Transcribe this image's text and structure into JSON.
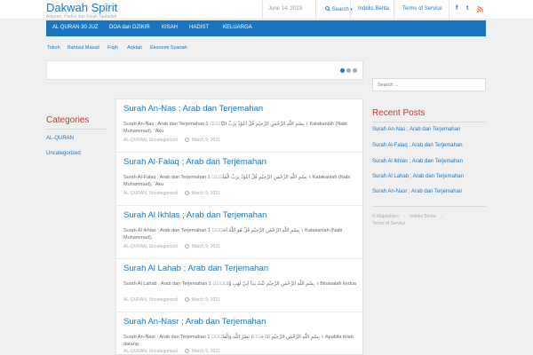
{
  "header": {
    "title": "Dakwah Spirit",
    "tagline": "Alquran, Hadist dan Kisah Tauladan",
    "date": "June 14, 2023",
    "search_label": "Search",
    "links": [
      "Indeks Berita",
      "Terms of Service"
    ],
    "social_icons": [
      "facebook-icon",
      "twitter-icon",
      "rss-icon"
    ],
    "facebook_glyph": "f",
    "twitter_glyph": "t"
  },
  "nav": {
    "items": [
      "AL QURAN 30 JUZ",
      "DOA dan DZIKIR",
      "KISAH",
      "HADIST",
      "KELUARGA"
    ]
  },
  "subnav": {
    "items": [
      "Tokoh",
      "Bahtsul Masail",
      "Fiqih",
      "Aqidah",
      "Ekonomi Syariah"
    ]
  },
  "sidebar_left": {
    "heading": "Categories",
    "categories": [
      "AL-QURAN",
      "Uncategorized"
    ]
  },
  "search": {
    "placeholder": "Search ..."
  },
  "posts": [
    {
      "title": "Surah An-Nas ; Arab dan Terjemahan",
      "excerpt": "Surah An-Nas ; Arab dan Terjemahan   1 ١ بِسْمِ اللّٰهِ الرَّحْمٰنِ الرَّحِيْمِ  قُلْ اَعُوْذُ بِرَبِّ النَّاسِۙ  Katakanlah (Nabi Muhammad), “Aku",
      "categories": "AL-QURAN, Uncategorized",
      "date": "March 9, 2021"
    },
    {
      "title": "Surah Al-Falaq ; Arab dan Terjemahan",
      "excerpt": "Surah Al-Falaq ; Arab dan Terjemahan   1 ١ بِسْمِ اللّٰهِ الرَّحْمٰنِ الرَّحِيْمِ  قُلْ اَعُوْذُ بِرَبِّ الْفَلَقِۙ  Katakanlah (Nabi Muhammad), “Aku",
      "categories": "AL-QURAN, Uncategorized",
      "date": "March 9, 2021"
    },
    {
      "title": "Surah Al Ikhlas ; Arab dan Terjemahan",
      "excerpt": "Surah Al Ikhlas ; Arab dan Terjemahan   1 ١ بِسْمِ اللّٰهِ الرَّحْمٰنِ الرَّحِيْمِ  قُلْ هُوَ اللّٰهُ اَحَدٌۚ  Katakanlah (Nabi Muhammad),",
      "categories": "AL-QURAN, Uncategorized",
      "date": "March 9, 2021"
    },
    {
      "title": "Surah Al Lahab ; Arab dan Terjemahan",
      "excerpt": "Surah Al Lahab ; Arab dan Terjemahan   1 ١ بِسْمِ اللّٰهِ الرَّحْمٰنِ الرَّحِيْمِ  تَبَّتْ يَدَآ اَبِيْ لَهَبٍ وَّتَبَّۗ  Binasalah kedua",
      "categories": "AL-QURAN, Uncategorized",
      "date": "March 9, 2021"
    },
    {
      "title": "Surah An-Nasr ; Arab dan Terjemahan",
      "excerpt": "Surah An-Nasr ; Arab dan Terjemahan   1 ١ بِسْمِ اللّٰهِ الرَّحْمٰنِ الرَّحِيْمِ  اِذَا جَاۤءَ نَصْرُ اللّٰهِ وَالْفَتْحُۙ  Apabila telah datang",
      "categories": "AL-QURAN, Uncategorized",
      "date": "March 9, 2021"
    }
  ],
  "sidebar_right": {
    "heading": "Recent Posts",
    "recent": [
      "Surah An-Nas ; Arab dan Terjemahan",
      "Surah Al-Falaq ; Arab dan Terjemahan",
      "Surah Al Ikhlas ; Arab dan Terjemahan",
      "Surah Al Lahab ; Arab dan Terjemahan",
      "Surah An-Nasr ; Arab dan Terjemahan"
    ],
    "footer_copyright": "© Majalahpro",
    "footer_links": [
      "Indeks Berita",
      "Terms of Service"
    ],
    "footer_separator": "-"
  },
  "colors": {
    "accent": "#1b74bf",
    "heading": "#c0392b",
    "rss": "#f26522"
  }
}
